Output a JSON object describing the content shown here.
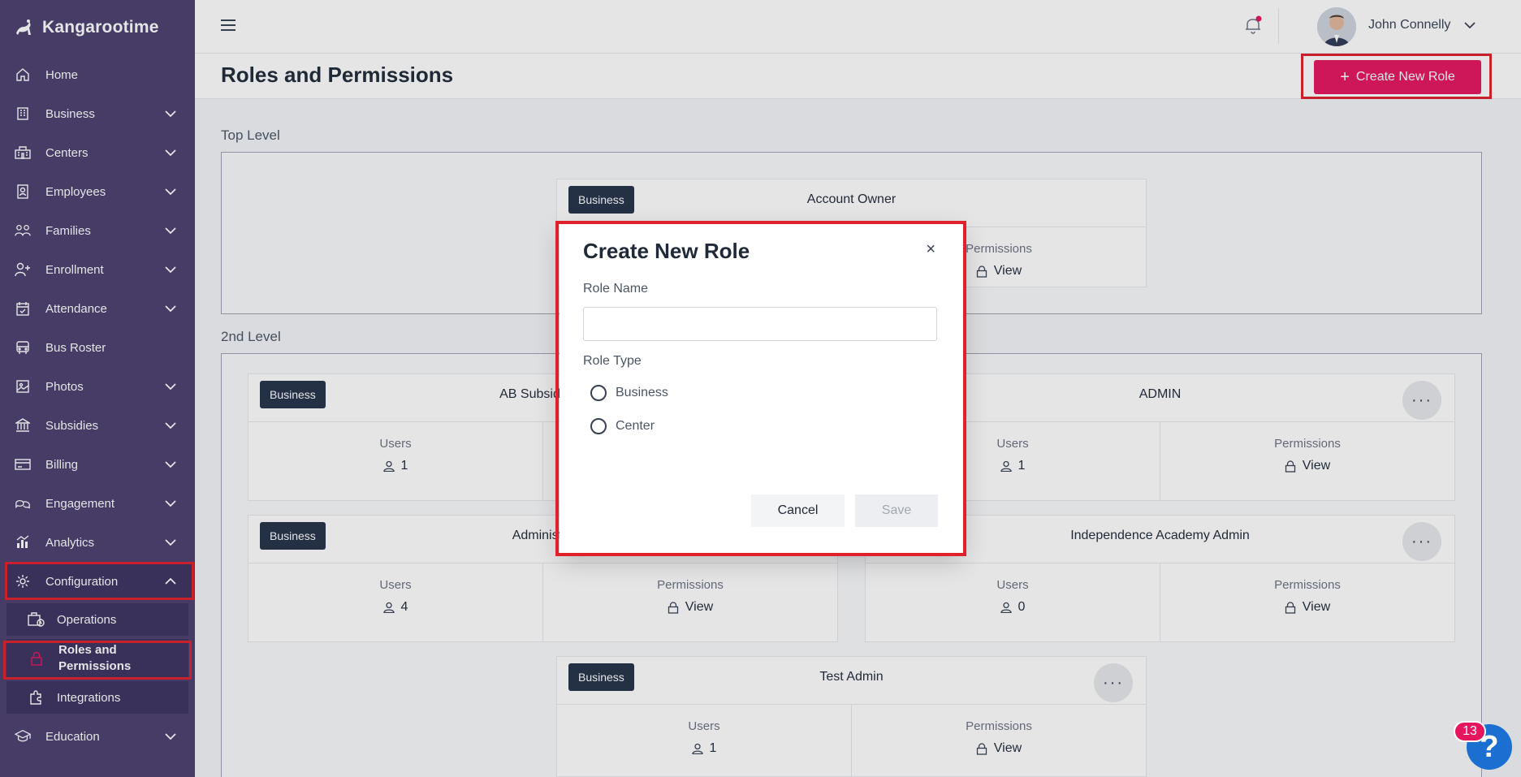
{
  "brand": {
    "name": "Kangarootime"
  },
  "sidebar": {
    "items": [
      {
        "label": "Home",
        "icon": "home-icon"
      },
      {
        "label": "Business",
        "icon": "building-icon"
      },
      {
        "label": "Centers",
        "icon": "school-icon"
      },
      {
        "label": "Employees",
        "icon": "badge-icon"
      },
      {
        "label": "Families",
        "icon": "users-icon"
      },
      {
        "label": "Enrollment",
        "icon": "user-plus-icon"
      },
      {
        "label": "Attendance",
        "icon": "calendar-check-icon"
      },
      {
        "label": "Bus Roster",
        "icon": "bus-icon"
      },
      {
        "label": "Photos",
        "icon": "image-icon"
      },
      {
        "label": "Subsidies",
        "icon": "bank-icon"
      },
      {
        "label": "Billing",
        "icon": "credit-card-icon"
      },
      {
        "label": "Engagement",
        "icon": "chat-icon"
      },
      {
        "label": "Analytics",
        "icon": "chart-icon"
      },
      {
        "label": "Configuration",
        "icon": "gear-icon"
      },
      {
        "label": "Education",
        "icon": "graduation-cap-icon"
      }
    ],
    "sub_items": [
      {
        "label": "Operations",
        "icon": "operations-icon"
      },
      {
        "label": "Roles and Permissions",
        "icon": "lock-icon"
      },
      {
        "label": "Integrations",
        "icon": "puzzle-icon"
      }
    ]
  },
  "topbar": {
    "user_name": "John Connelly"
  },
  "page": {
    "title": "Roles and Permissions",
    "create_button": "Create New Role"
  },
  "levels": {
    "top": "Top Level",
    "second": "2nd Level"
  },
  "cards": {
    "account_owner": {
      "badge": "Business",
      "name": "Account Owner",
      "perm_label": "Permissions",
      "perm_value": "View"
    },
    "ab_subsidy": {
      "badge": "Business",
      "name": "AB Subsidy Sp",
      "users_label": "Users",
      "users_value": "1"
    },
    "admin": {
      "name": "ADMIN",
      "users_label": "Users",
      "users_value": "1",
      "perm_label": "Permissions",
      "perm_value": "View"
    },
    "administrator": {
      "badge": "Business",
      "name": "Administra",
      "users_label": "Users",
      "users_value": "4",
      "perm_label": "Permissions",
      "perm_value": "View"
    },
    "independence": {
      "name": "Independence Academy Admin",
      "users_label": "Users",
      "users_value": "0",
      "perm_label": "Permissions",
      "perm_value": "View"
    },
    "test_admin": {
      "badge": "Business",
      "name": "Test Admin",
      "users_label": "Users",
      "users_value": "1",
      "perm_label": "Permissions",
      "perm_value": "View"
    }
  },
  "modal": {
    "title": "Create New Role",
    "close": "×",
    "role_name_label": "Role Name",
    "role_name_value": "",
    "role_type_label": "Role Type",
    "options": [
      "Business",
      "Center"
    ],
    "cancel": "Cancel",
    "save": "Save"
  },
  "help": {
    "badge_count": "13",
    "symbol": "?"
  },
  "colors": {
    "sidebar": "#4a3f6e",
    "accent": "#e5155e",
    "badge": "#243247",
    "highlight": "#e0202c"
  }
}
